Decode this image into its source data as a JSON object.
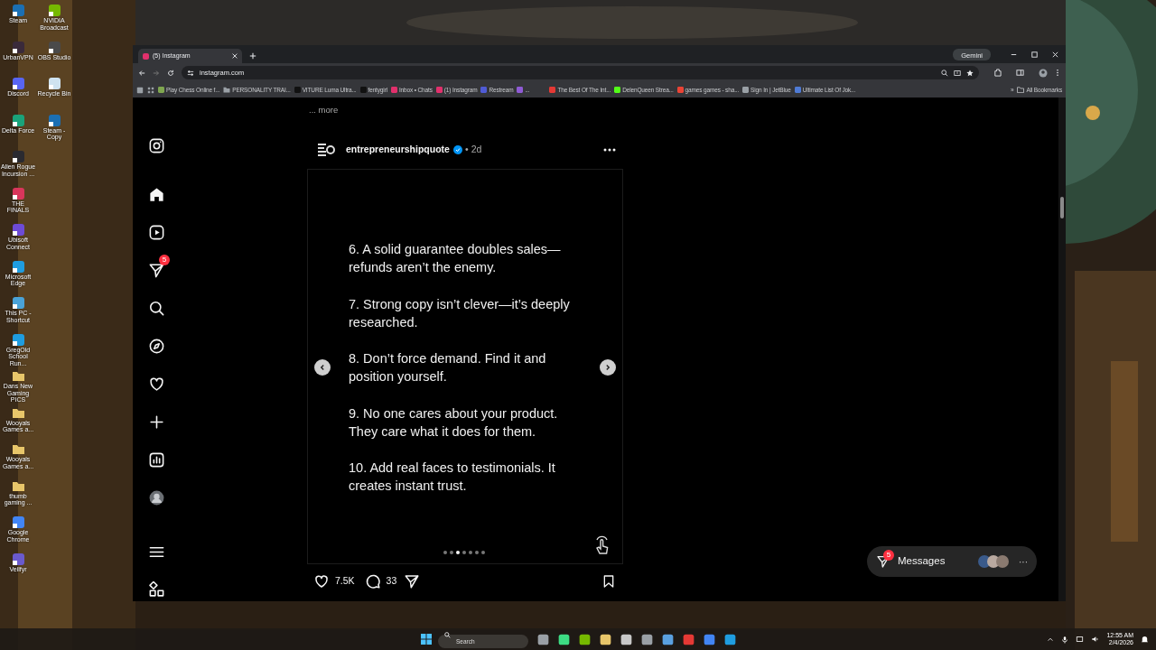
{
  "desktop": {
    "columns": [
      [
        {
          "label": "Steam",
          "color": "#1b6fb3",
          "kind": "app"
        },
        {
          "label": "UrbanVPN",
          "color": "#3a2a3a",
          "kind": "app"
        },
        {
          "label": "Discord",
          "color": "#5865f2",
          "kind": "app"
        },
        {
          "label": "Delta Force",
          "color": "#1aa37a",
          "kind": "app"
        },
        {
          "label": "Alien Rogue Incursion ...",
          "color": "#2a2a30",
          "kind": "app"
        },
        {
          "label": "THE FINALS",
          "color": "#d9365b",
          "kind": "app"
        },
        {
          "label": "Ubisoft Connect",
          "color": "#6d4bd6",
          "kind": "app"
        },
        {
          "label": "Microsoft Edge",
          "color": "#1f9de0",
          "kind": "app"
        },
        {
          "label": "This PC - Shortcut",
          "color": "#4aa3d8",
          "kind": "app"
        },
        {
          "label": "GregOld School Run...",
          "color": "#1f9de0",
          "kind": "app"
        },
        {
          "label": "Dans New Gaming PICS",
          "color": "#e8c66a",
          "kind": "folder"
        },
        {
          "label": "Wooyals Games a...",
          "color": "#e8c66a",
          "kind": "folder"
        },
        {
          "label": "Wooyals Games a...",
          "color": "#e8c66a",
          "kind": "folder"
        },
        {
          "label": "thumb gaming ...",
          "color": "#e8c66a",
          "kind": "folder"
        },
        {
          "label": "Google Chrome",
          "color": "#4285f4",
          "kind": "app"
        },
        {
          "label": "Veilfyr",
          "color": "#6a5acd",
          "kind": "app"
        }
      ],
      [
        {
          "label": "NVIDIA Broadcast",
          "color": "#76b900",
          "kind": "app"
        },
        {
          "label": "OBS Studio",
          "color": "#4a4a4a",
          "kind": "app"
        },
        {
          "label": "Recycle Bin",
          "color": "#cfe3f0",
          "kind": "app"
        },
        {
          "label": "Steam - Copy",
          "color": "#1b6fb3",
          "kind": "app"
        }
      ]
    ]
  },
  "browser": {
    "tabs": [
      {
        "title": "(5) Instagram",
        "selected": true
      }
    ],
    "gemini": "Gemini",
    "address": "instagram.com",
    "bookmarks": [
      {
        "label": "Play Chess Online f...",
        "color": "#7fa650"
      },
      {
        "label": "PERSONALITY TRAI...",
        "color": "#9aa0a6",
        "kind": "folder"
      },
      {
        "label": "VITURE Luma Ultra...",
        "color": "#111111"
      },
      {
        "label": "fentygirl",
        "color": "#111111"
      },
      {
        "label": "Inbox • Chats",
        "color": "#e1306c"
      },
      {
        "label": "(1) Instagram",
        "color": "#e1306c"
      },
      {
        "label": "Restream",
        "color": "#4f5bd5"
      },
      {
        "label": "...",
        "color": "#8f5bd5"
      },
      {
        "label": "The Best Of The Int...",
        "color": "#e53935"
      },
      {
        "label": "DelenQueen Strea...",
        "color": "#53fc18"
      },
      {
        "label": "games games - sha...",
        "color": "#ea4335"
      },
      {
        "label": "Sign In | JetBlue",
        "color": "#9aa0a6"
      },
      {
        "label": "Ultimate List Of Jok...",
        "color": "#4f7bd5"
      }
    ],
    "overflow": "»",
    "all_bookmarks": "All Bookmarks"
  },
  "instagram": {
    "nav": [
      {
        "kind": "logo"
      },
      {
        "kind": "home"
      },
      {
        "kind": "reels"
      },
      {
        "kind": "messages",
        "badge": "5"
      },
      {
        "kind": "search"
      },
      {
        "kind": "explore"
      },
      {
        "kind": "notifications"
      },
      {
        "kind": "create"
      },
      {
        "kind": "dashboard"
      },
      {
        "kind": "profile"
      },
      {
        "kind": "menu"
      },
      {
        "kind": "more"
      }
    ],
    "caption_more": "... more",
    "post": {
      "author": "entrepreneurshipquote",
      "verified": true,
      "separator": "•",
      "time": "2d",
      "slide": [
        [
          "6. A solid guarantee doubles sales—",
          "refunds aren’t the enemy."
        ],
        [
          "7. Strong copy isn’t clever—it’s deeply",
          "researched."
        ],
        [
          "8. Don’t force demand. Find it and",
          "position yourself."
        ],
        [
          "9. No one cares about your product.",
          "They care what it does for them."
        ],
        [
          "10. Add real faces to testimonials. It",
          "creates instant trust."
        ]
      ],
      "dots": [
        {
          "selected": false
        },
        {
          "selected": false
        },
        {
          "selected": true
        },
        {
          "selected": false
        },
        {
          "selected": false
        },
        {
          "selected": false
        },
        {
          "selected": false
        }
      ],
      "likes": "7.5K",
      "comments": "33"
    },
    "messages": {
      "badge": "5",
      "label": "Messages",
      "more": "···"
    }
  },
  "taskbar": {
    "search": {
      "placeholder": "Search"
    },
    "apps": [
      {
        "color": "#9aa0a6"
      },
      {
        "color": "#3ddc84"
      },
      {
        "color": "#76b900"
      },
      {
        "color": "#e8c66a"
      },
      {
        "color": "#c8c8c8"
      },
      {
        "color": "#9aa0a6"
      },
      {
        "color": "#5aa0e0"
      },
      {
        "color": "#e53935"
      },
      {
        "color": "#4285f4"
      },
      {
        "color": "#1f9de0"
      }
    ],
    "time": "12:55 AM",
    "date": "2/4/2026"
  }
}
